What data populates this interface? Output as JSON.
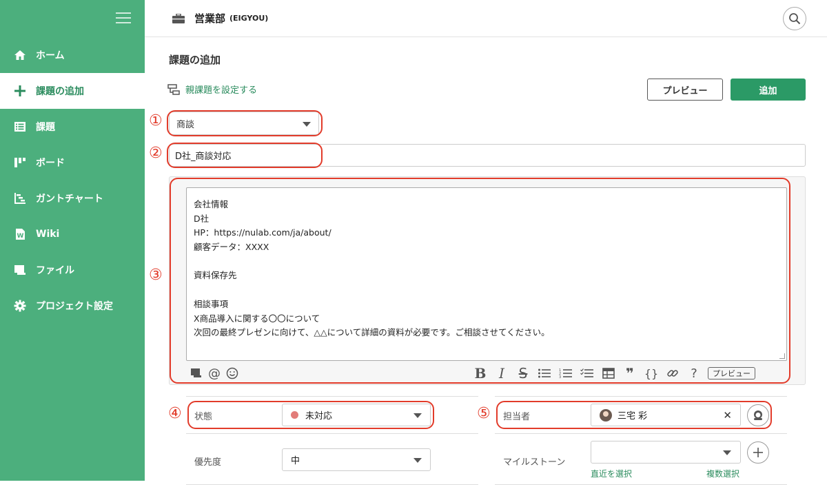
{
  "sidebar": {
    "items": [
      {
        "label": "ホーム",
        "icon": "home-icon"
      },
      {
        "label": "課題の追加",
        "icon": "plus-icon"
      },
      {
        "label": "課題",
        "icon": "list-icon"
      },
      {
        "label": "ボード",
        "icon": "board-icon"
      },
      {
        "label": "ガントチャート",
        "icon": "gantt-icon"
      },
      {
        "label": "Wiki",
        "icon": "wiki-icon"
      },
      {
        "label": "ファイル",
        "icon": "folder-icon"
      },
      {
        "label": "プロジェクト設定",
        "icon": "gear-icon"
      }
    ],
    "active_index": 1
  },
  "header": {
    "project_name": "営業部",
    "project_key": "(EIGYOU)"
  },
  "page": {
    "title": "課題の追加",
    "parent_link": "親課題を設定する",
    "preview_button": "プレビュー",
    "add_button": "追加"
  },
  "form": {
    "issue_type": "商談",
    "subject": "D社_商談対応",
    "description_lines": [
      "会社情報",
      "D社",
      "HP：https://nulab.com/ja/about/",
      "顧客データ：XXXX",
      "",
      "資料保存先",
      "",
      "相談事項",
      "X商品導入に関する〇〇について",
      "次回の最終プレゼンに向けて、△△について詳細の資料が必要です。ご相談させてください。"
    ],
    "toolbar_preview": "プレビュー",
    "status_label": "状態",
    "status_value": "未対応",
    "assignee_label": "担当者",
    "assignee_value": "三宅 彩",
    "priority_label": "優先度",
    "priority_value": "中",
    "milestone_label": "マイルストーン",
    "milestone_value": "",
    "recent_link": "直近を選択",
    "multi_link": "複数選択"
  },
  "annotations": {
    "numbers": [
      "①",
      "②",
      "③",
      "④",
      "⑤"
    ],
    "color": "#e23b2a"
  },
  "colors": {
    "sidebar": "#4caf7d",
    "accent": "#2b9a66",
    "status_dot": "#e27c79"
  }
}
